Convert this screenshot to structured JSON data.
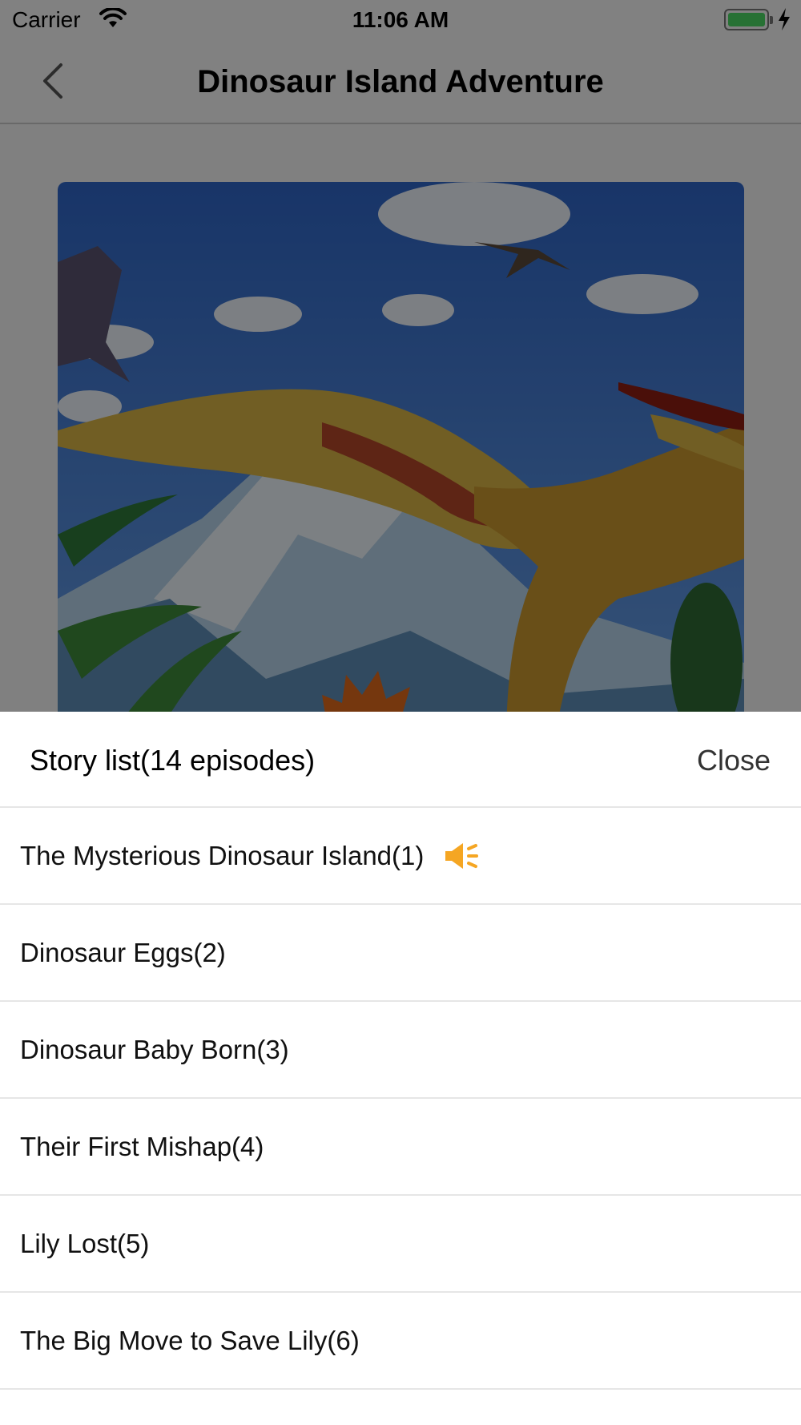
{
  "status_bar": {
    "carrier": "Carrier",
    "time": "11:06 AM"
  },
  "nav": {
    "title": "Dinosaur Island Adventure"
  },
  "cover": {
    "description_icon": "pterodactyl-cover-illustration"
  },
  "sheet": {
    "title": "Story list(14 episodes)",
    "close_label": "Close",
    "episodes": [
      {
        "label": "The Mysterious Dinosaur Island(1)",
        "playing": true
      },
      {
        "label": "Dinosaur Eggs(2)"
      },
      {
        "label": "Dinosaur Baby Born(3)"
      },
      {
        "label": "Their First Mishap(4)"
      },
      {
        "label": "Lily Lost(5)"
      },
      {
        "label": "The Big Move to Save Lily(6)"
      }
    ]
  },
  "colors": {
    "playing_icon": "#f5a623",
    "battery": "#4cd964"
  }
}
